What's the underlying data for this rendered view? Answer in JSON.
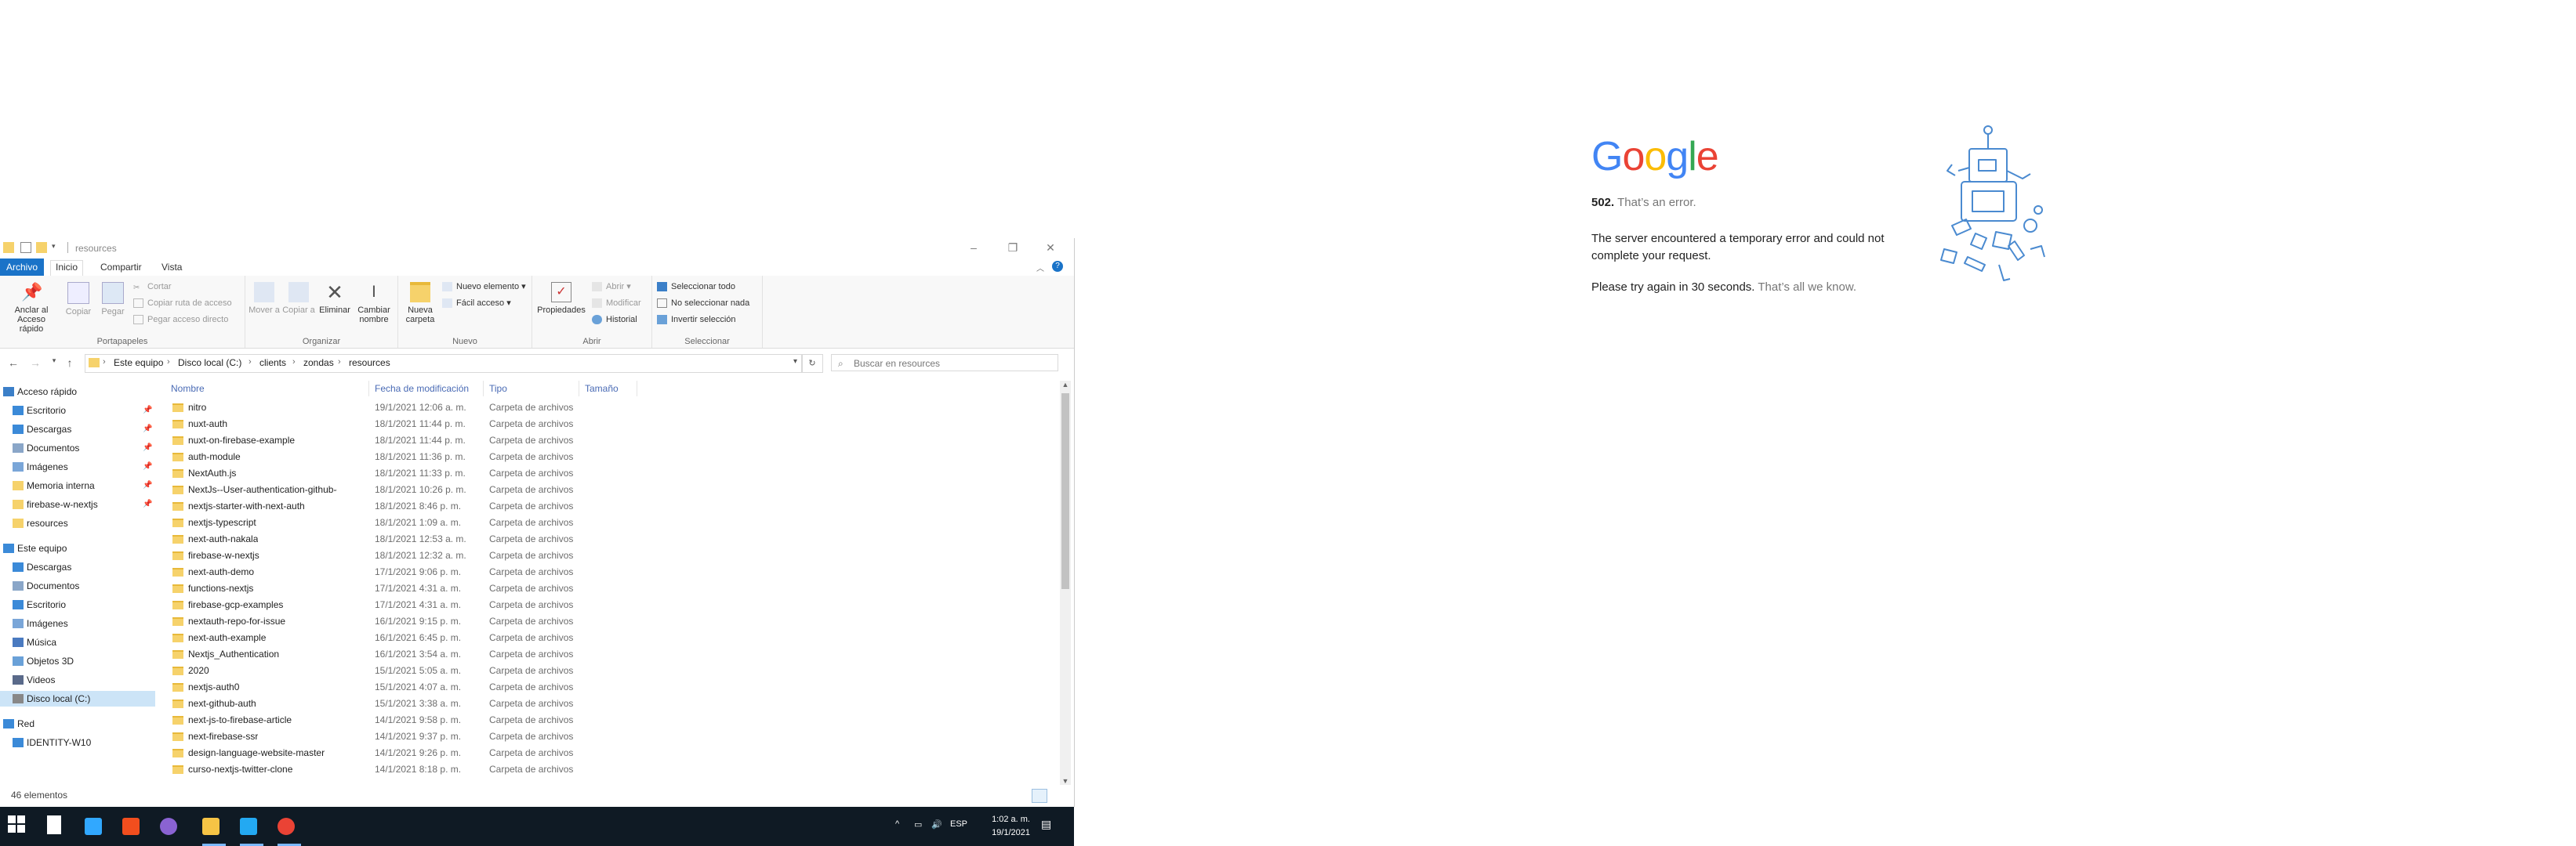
{
  "google_error": {
    "logo_letters": [
      {
        "ch": "G",
        "color": "#4285F4"
      },
      {
        "ch": "o",
        "color": "#EA4335"
      },
      {
        "ch": "o",
        "color": "#FBBC05"
      },
      {
        "ch": "g",
        "color": "#4285F4"
      },
      {
        "ch": "l",
        "color": "#34A853"
      },
      {
        "ch": "e",
        "color": "#EA4335"
      }
    ],
    "code": "502.",
    "code_text": "That’s an error.",
    "message": "The server encountered a temporary error and could not complete your request.",
    "retry": "Please try again in 30 seconds.",
    "retry_muted": "That’s all we know."
  },
  "explorer": {
    "title": "resources",
    "ribbon_tabs": [
      "Archivo",
      "Inicio",
      "Compartir",
      "Vista"
    ],
    "groups": {
      "portapapeles": {
        "label": "Portapapeles",
        "pin": "Anclar al Acceso rápido",
        "copy": "Copiar",
        "paste": "Pegar",
        "cut": "Cortar",
        "copy_path": "Copiar ruta de acceso",
        "paste_shortcut": "Pegar acceso directo"
      },
      "organizar": {
        "label": "Organizar",
        "move": "Mover a",
        "copy_to": "Copiar a",
        "delete": "Eliminar",
        "rename": "Cambiar nombre"
      },
      "nuevo": {
        "label": "Nuevo",
        "new_folder": "Nueva carpeta",
        "new_item": "Nuevo elemento",
        "easy_access": "Fácil acceso"
      },
      "abrir": {
        "label": "Abrir",
        "properties": "Propiedades",
        "open": "Abrir",
        "edit": "Modificar",
        "history": "Historial"
      },
      "seleccionar": {
        "label": "Seleccionar",
        "select_all": "Seleccionar todo",
        "select_none": "No seleccionar nada",
        "invert": "Invertir selección"
      }
    },
    "breadcrumb": [
      "Este equipo",
      "Disco local (C:)",
      "clients",
      "zondas",
      "resources"
    ],
    "search_placeholder": "Buscar en resources",
    "nav": [
      {
        "label": "Acceso rápido",
        "indent": 0,
        "icon": "star-icon",
        "pin": false
      },
      {
        "label": "Escritorio",
        "indent": 1,
        "icon": "desktop-icon",
        "pin": true
      },
      {
        "label": "Descargas",
        "indent": 1,
        "icon": "download-icon",
        "pin": true
      },
      {
        "label": "Documentos",
        "indent": 1,
        "icon": "documents-icon",
        "pin": true
      },
      {
        "label": "Imágenes",
        "indent": 1,
        "icon": "pictures-icon",
        "pin": true
      },
      {
        "label": "Memoria interna",
        "indent": 1,
        "icon": "folder-icon",
        "pin": true
      },
      {
        "label": "firebase-w-nextjs",
        "indent": 1,
        "icon": "folder-icon",
        "pin": true
      },
      {
        "label": "resources",
        "indent": 1,
        "icon": "folder-icon",
        "pin": false
      },
      {
        "label": "",
        "indent": 0,
        "icon": "",
        "pin": false
      },
      {
        "label": "Este equipo",
        "indent": 0,
        "icon": "computer-icon",
        "pin": false
      },
      {
        "label": "Descargas",
        "indent": 1,
        "icon": "download-icon",
        "pin": false
      },
      {
        "label": "Documentos",
        "indent": 1,
        "icon": "documents-icon",
        "pin": false
      },
      {
        "label": "Escritorio",
        "indent": 1,
        "icon": "desktop-icon",
        "pin": false
      },
      {
        "label": "Imágenes",
        "indent": 1,
        "icon": "pictures-icon",
        "pin": false
      },
      {
        "label": "Música",
        "indent": 1,
        "icon": "music-icon",
        "pin": false
      },
      {
        "label": "Objetos 3D",
        "indent": 1,
        "icon": "objects3d-icon",
        "pin": false
      },
      {
        "label": "Videos",
        "indent": 1,
        "icon": "videos-icon",
        "pin": false
      },
      {
        "label": "Disco local (C:)",
        "indent": 1,
        "icon": "drive-icon",
        "pin": false,
        "selected": true
      },
      {
        "label": "",
        "indent": 0,
        "icon": "",
        "pin": false
      },
      {
        "label": "Red",
        "indent": 0,
        "icon": "network-icon",
        "pin": false
      },
      {
        "label": "IDENTITY-W10",
        "indent": 1,
        "icon": "computer-icon",
        "pin": false
      }
    ],
    "columns": [
      "Nombre",
      "Fecha de modificación",
      "Tipo",
      "Tamaño"
    ],
    "files": [
      {
        "name": "nitro",
        "date": "19/1/2021 12:06 a. m.",
        "type": "Carpeta de archivos"
      },
      {
        "name": "nuxt-auth",
        "date": "18/1/2021 11:44 p. m.",
        "type": "Carpeta de archivos"
      },
      {
        "name": "nuxt-on-firebase-example",
        "date": "18/1/2021 11:44 p. m.",
        "type": "Carpeta de archivos"
      },
      {
        "name": "auth-module",
        "date": "18/1/2021 11:36 p. m.",
        "type": "Carpeta de archivos"
      },
      {
        "name": "NextAuth.js",
        "date": "18/1/2021 11:33 p. m.",
        "type": "Carpeta de archivos"
      },
      {
        "name": "NextJs--User-authentication-github-goo...",
        "date": "18/1/2021 10:26 p. m.",
        "type": "Carpeta de archivos"
      },
      {
        "name": "nextjs-starter-with-next-auth",
        "date": "18/1/2021 8:46 p. m.",
        "type": "Carpeta de archivos"
      },
      {
        "name": "nextjs-typescript",
        "date": "18/1/2021 1:09 a. m.",
        "type": "Carpeta de archivos"
      },
      {
        "name": "next-auth-nakala",
        "date": "18/1/2021 12:53 a. m.",
        "type": "Carpeta de archivos"
      },
      {
        "name": "firebase-w-nextjs",
        "date": "18/1/2021 12:32 a. m.",
        "type": "Carpeta de archivos"
      },
      {
        "name": "next-auth-demo",
        "date": "17/1/2021 9:06 p. m.",
        "type": "Carpeta de archivos"
      },
      {
        "name": "functions-nextjs",
        "date": "17/1/2021 4:31 a. m.",
        "type": "Carpeta de archivos"
      },
      {
        "name": "firebase-gcp-examples",
        "date": "17/1/2021 4:31 a. m.",
        "type": "Carpeta de archivos"
      },
      {
        "name": "nextauth-repo-for-issue",
        "date": "16/1/2021 9:15 p. m.",
        "type": "Carpeta de archivos"
      },
      {
        "name": "next-auth-example",
        "date": "16/1/2021 6:45 p. m.",
        "type": "Carpeta de archivos"
      },
      {
        "name": "Nextjs_Authentication",
        "date": "16/1/2021 3:54 a. m.",
        "type": "Carpeta de archivos"
      },
      {
        "name": "2020",
        "date": "15/1/2021 5:05 a. m.",
        "type": "Carpeta de archivos"
      },
      {
        "name": "nextjs-auth0",
        "date": "15/1/2021 4:07 a. m.",
        "type": "Carpeta de archivos"
      },
      {
        "name": "next-github-auth",
        "date": "15/1/2021 3:38 a. m.",
        "type": "Carpeta de archivos"
      },
      {
        "name": "next-js-to-firebase-article",
        "date": "14/1/2021 9:58 p. m.",
        "type": "Carpeta de archivos"
      },
      {
        "name": "next-firebase-ssr",
        "date": "14/1/2021 9:37 p. m.",
        "type": "Carpeta de archivos"
      },
      {
        "name": "design-language-website-master",
        "date": "14/1/2021 9:26 p. m.",
        "type": "Carpeta de archivos"
      },
      {
        "name": "curso-nextjs-twitter-clone",
        "date": "14/1/2021 8:18 p. m.",
        "type": "Carpeta de archivos"
      }
    ],
    "status": "46 elementos"
  },
  "taskbar": {
    "icons": [
      {
        "name": "windows-start-icon",
        "color": "#ffffff"
      },
      {
        "name": "search-icon",
        "color": "#ffffff"
      },
      {
        "name": "photoshop-icon",
        "color": "#31a8ff"
      },
      {
        "name": "figma-icon",
        "color": "#f24e1e"
      },
      {
        "name": "app-icon",
        "color": "#8a63d2"
      },
      {
        "name": "file-explorer-icon",
        "color": "#f6c445"
      },
      {
        "name": "vscode-icon",
        "color": "#23a9f2"
      },
      {
        "name": "chrome-icon",
        "color": "#ea4335"
      }
    ],
    "language": "ESP",
    "time": "1:02 a. m.",
    "date": "19/1/2021"
  }
}
